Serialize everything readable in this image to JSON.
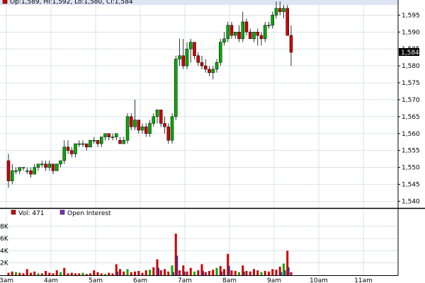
{
  "header": {
    "ohlc_text": "Op:1,589, Hi:1,592, Lo:1,580, Cl:1,584"
  },
  "volume_legend": {
    "volume_text": "Vol: 471",
    "oi_text": "Open Interest"
  },
  "colors": {
    "up": "#00aa00",
    "down": "#cc0000",
    "volume": "#cc0000",
    "oi": "#333399",
    "grid": "#c8d0da",
    "header_bg": "#dde4f4",
    "price_tag_bg": "#000000"
  },
  "chart_data": [
    {
      "type": "candlestick",
      "x_ticks": [
        "3am",
        "4am",
        "5am",
        "6am",
        "7am",
        "8am",
        "9am",
        "10am",
        "11am"
      ],
      "y_ticks": [
        1540,
        1545,
        1550,
        1555,
        1560,
        1565,
        1570,
        1575,
        1580,
        1585,
        1590,
        1595
      ],
      "y_tick_labels": [
        "1,540",
        "1,545",
        "1,550",
        "1,555",
        "1,560",
        "1,565",
        "1,570",
        "1,575",
        "1,580",
        "1,585",
        "1,590",
        "1,595"
      ],
      "ylim": [
        1538,
        1598
      ],
      "last_price_label": "1,584",
      "last_price": 1584,
      "start_hour": 3,
      "bar_minutes": 5,
      "grid": true,
      "candles": [
        [
          1552,
          1554,
          1544,
          1546
        ],
        [
          1546,
          1551,
          1545,
          1549
        ],
        [
          1549,
          1550,
          1548,
          1549
        ],
        [
          1549,
          1550,
          1548,
          1550
        ],
        [
          1550,
          1550,
          1549,
          1550
        ],
        [
          1549,
          1550,
          1548,
          1549
        ],
        [
          1549,
          1550,
          1547,
          1548
        ],
        [
          1548,
          1551,
          1548,
          1550
        ],
        [
          1550,
          1551,
          1549,
          1551
        ],
        [
          1551,
          1552,
          1550,
          1551
        ],
        [
          1551,
          1552,
          1549,
          1550
        ],
        [
          1550,
          1552,
          1549,
          1551
        ],
        [
          1551,
          1551,
          1548,
          1549
        ],
        [
          1549,
          1551,
          1549,
          1551
        ],
        [
          1551,
          1552,
          1550,
          1552
        ],
        [
          1552,
          1558,
          1551,
          1556
        ],
        [
          1556,
          1558,
          1554,
          1555
        ],
        [
          1555,
          1556,
          1553,
          1554
        ],
        [
          1554,
          1557,
          1553,
          1557
        ],
        [
          1557,
          1558,
          1556,
          1557
        ],
        [
          1557,
          1558,
          1556,
          1557
        ],
        [
          1557,
          1557,
          1555,
          1556
        ],
        [
          1556,
          1558,
          1556,
          1558
        ],
        [
          1558,
          1559,
          1557,
          1558
        ],
        [
          1558,
          1558,
          1556,
          1557
        ],
        [
          1557,
          1559,
          1556,
          1559
        ],
        [
          1559,
          1560,
          1558,
          1560
        ],
        [
          1560,
          1560,
          1558,
          1559
        ],
        [
          1559,
          1560,
          1558,
          1559
        ],
        [
          1559,
          1560,
          1558,
          1560
        ],
        [
          1558,
          1559,
          1557,
          1557
        ],
        [
          1557,
          1559,
          1557,
          1558
        ],
        [
          1558,
          1566,
          1557,
          1565
        ],
        [
          1565,
          1566,
          1561,
          1562
        ],
        [
          1562,
          1570,
          1561,
          1564
        ],
        [
          1564,
          1564,
          1560,
          1561
        ],
        [
          1561,
          1563,
          1560,
          1562
        ],
        [
          1562,
          1563,
          1559,
          1560
        ],
        [
          1560,
          1564,
          1559,
          1563
        ],
        [
          1563,
          1566,
          1562,
          1565
        ],
        [
          1565,
          1567,
          1563,
          1567
        ],
        [
          1567,
          1567,
          1562,
          1563
        ],
        [
          1563,
          1565,
          1560,
          1562
        ],
        [
          1562,
          1563,
          1557,
          1558
        ],
        [
          1558,
          1566,
          1557,
          1565
        ],
        [
          1565,
          1583,
          1564,
          1582
        ],
        [
          1582,
          1588,
          1580,
          1583
        ],
        [
          1583,
          1588,
          1579,
          1580
        ],
        [
          1580,
          1587,
          1579,
          1585
        ],
        [
          1585,
          1588,
          1581,
          1587
        ],
        [
          1587,
          1587,
          1582,
          1583
        ],
        [
          1583,
          1584,
          1580,
          1581
        ],
        [
          1581,
          1583,
          1579,
          1580
        ],
        [
          1580,
          1582,
          1578,
          1579
        ],
        [
          1579,
          1580,
          1577,
          1578
        ],
        [
          1578,
          1580,
          1576,
          1579
        ],
        [
          1579,
          1582,
          1578,
          1581
        ],
        [
          1581,
          1588,
          1580,
          1587
        ],
        [
          1587,
          1590,
          1586,
          1588
        ],
        [
          1588,
          1593,
          1587,
          1592
        ],
        [
          1592,
          1593,
          1588,
          1589
        ],
        [
          1589,
          1590,
          1588,
          1590
        ],
        [
          1590,
          1592,
          1587,
          1588
        ],
        [
          1588,
          1596,
          1587,
          1593
        ],
        [
          1593,
          1594,
          1589,
          1590
        ],
        [
          1590,
          1591,
          1588,
          1588
        ],
        [
          1588,
          1590,
          1587,
          1590
        ],
        [
          1590,
          1591,
          1586,
          1589
        ],
        [
          1589,
          1590,
          1586,
          1588
        ],
        [
          1588,
          1593,
          1587,
          1592
        ],
        [
          1592,
          1593,
          1591,
          1592
        ],
        [
          1592,
          1596,
          1591,
          1595
        ],
        [
          1595,
          1599,
          1594,
          1597
        ],
        [
          1597,
          1599,
          1595,
          1596
        ],
        [
          1596,
          1598,
          1594,
          1597
        ],
        [
          1597,
          1598,
          1589,
          1589
        ],
        [
          1589,
          1592,
          1580,
          1584
        ]
      ]
    },
    {
      "type": "bar",
      "series_names": [
        "Vol",
        "Open Interest"
      ],
      "y_ticks": [
        2,
        4,
        6,
        8
      ],
      "y_tick_labels": [
        "2K",
        "4K",
        "6K",
        "8K"
      ],
      "ylim": [
        0,
        9.6
      ],
      "volume_k": [
        0.4,
        0.6,
        0.5,
        0.4,
        0.3,
        1.0,
        0.4,
        0.6,
        0.3,
        0.3,
        0.7,
        0.4,
        0.3,
        0.8,
        0.5,
        1.2,
        0.3,
        0.4,
        0.3,
        0.3,
        0.4,
        0.2,
        0.3,
        0.8,
        0.5,
        0.3,
        0.2,
        0.4,
        0.3,
        1.8,
        1.0,
        0.6,
        1.0,
        0.5,
        0.6,
        0.7,
        0.4,
        0.8,
        0.9,
        1.3,
        2.6,
        0.8,
        1.0,
        0.6,
        1.6,
        6.8,
        0.8,
        1.6,
        0.6,
        1.2,
        0.6,
        0.8,
        1.8,
        0.5,
        0.7,
        0.9,
        1.2,
        1.5,
        1.0,
        3.5,
        0.8,
        0.7,
        0.5,
        1.6,
        0.7,
        0.6,
        1.0,
        0.8,
        0.5,
        0.7,
        0.6,
        1.0,
        0.9,
        1.4,
        1.9,
        4.0,
        0.5
      ],
      "oi_k": [
        0.2,
        0.3,
        0.1,
        0.2,
        0.1,
        0.3,
        0.2,
        0.2,
        0.1,
        0.1,
        0.3,
        0.2,
        0.1,
        0.3,
        0.2,
        0.4,
        0.1,
        0.2,
        0.1,
        0.1,
        0.2,
        0.1,
        0.1,
        0.3,
        0.2,
        0.1,
        0.1,
        0.2,
        0.1,
        0.6,
        0.3,
        0.2,
        0.3,
        0.2,
        0.2,
        0.3,
        0.2,
        0.3,
        0.3,
        0.4,
        1.2,
        0.3,
        0.3,
        0.2,
        0.5,
        3.2,
        0.3,
        0.6,
        0.2,
        0.4,
        0.2,
        0.3,
        0.7,
        0.2,
        0.3,
        0.3,
        0.4,
        0.6,
        0.4,
        1.5,
        0.3,
        0.3,
        0.2,
        0.6,
        0.3,
        0.2,
        0.4,
        0.3,
        0.2,
        0.3,
        0.2,
        0.4,
        0.3,
        0.5,
        0.8,
        1.3,
        0.2
      ]
    }
  ]
}
